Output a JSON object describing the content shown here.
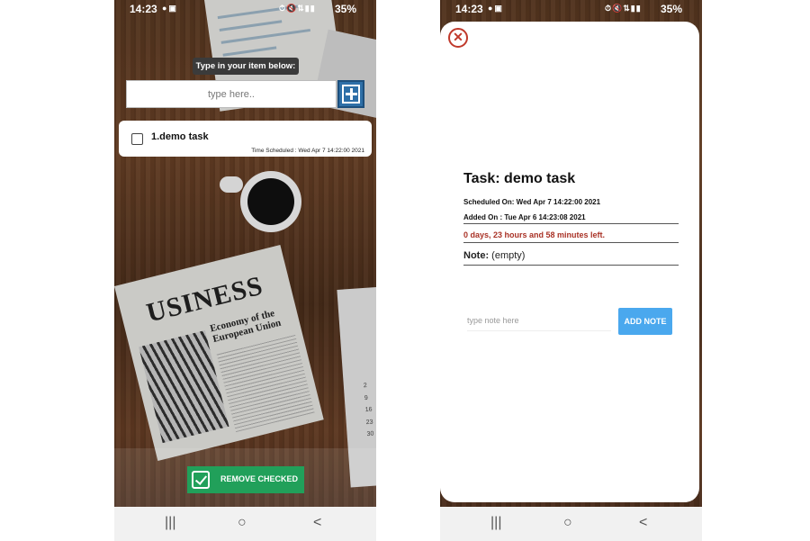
{
  "status_bar": {
    "time": "14:23",
    "battery": "35%"
  },
  "left_screen": {
    "prompt_label": "Type in your item below:",
    "input_placeholder": "type here..",
    "tasks": [
      {
        "title": "1.demo task",
        "scheduled": "Time Scheduled : Wed Apr  7 14:22:00 2021",
        "checked": false
      }
    ],
    "remove_checked_label": "REMOVE CHECKED",
    "newspaper": {
      "masthead": "USINESS",
      "headline": "Economy of the European Union"
    },
    "calendar_numbers": [
      "2",
      "9",
      "16",
      "23",
      "30"
    ]
  },
  "right_screen": {
    "task_title": "Task: demo task",
    "scheduled_on": "Scheduled On: Wed Apr  7 14:22:00 2021",
    "added_on": "Added On : Tue Apr  6 14:23:08 2021",
    "time_left": "0 days, 23 hours and 58 minutes left.",
    "note_label": "Note:",
    "note_value": "(empty)",
    "note_input_placeholder": "type note here",
    "add_note_label": "ADD NOTE"
  },
  "nav_bar": {
    "recents_icon": "|||",
    "home_icon": "○",
    "back_icon": "<"
  },
  "colors": {
    "accent_green": "#21a05a",
    "add_blue": "#2e6fa7",
    "add_note_blue": "#4aa8ee",
    "warning_red": "#a93226"
  }
}
